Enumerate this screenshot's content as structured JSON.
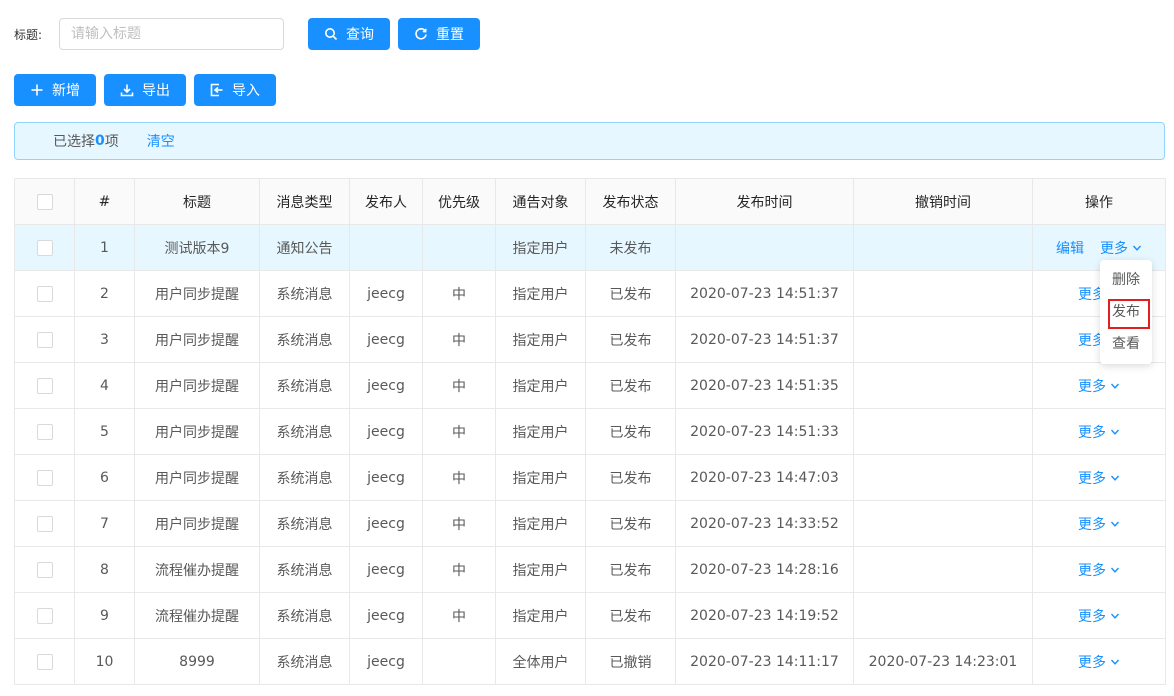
{
  "search": {
    "label": "标题:",
    "placeholder": "请输入标题",
    "query_label": "查询",
    "reset_label": "重置"
  },
  "toolbar": {
    "add_label": "新增",
    "export_label": "导出",
    "import_label": "导入"
  },
  "alert": {
    "prefix": "已选择",
    "count": "0",
    "suffix": "项",
    "clear_label": "清空"
  },
  "table": {
    "columns": [
      "#",
      "标题",
      "消息类型",
      "发布人",
      "优先级",
      "通告对象",
      "发布状态",
      "发布时间",
      "撤销时间",
      "操作"
    ],
    "rows": [
      {
        "idx": "1",
        "title": "测试版本9",
        "type": "通知公告",
        "publisher": "",
        "priority": "",
        "target": "指定用户",
        "status": "未发布",
        "publish_time": "",
        "revoke_time": "",
        "edit": "编辑",
        "more": "更多"
      },
      {
        "idx": "2",
        "title": "用户同步提醒",
        "type": "系统消息",
        "publisher": "jeecg",
        "priority": "中",
        "target": "指定用户",
        "status": "已发布",
        "publish_time": "2020-07-23 14:51:37",
        "revoke_time": "",
        "edit": "",
        "more": "更多"
      },
      {
        "idx": "3",
        "title": "用户同步提醒",
        "type": "系统消息",
        "publisher": "jeecg",
        "priority": "中",
        "target": "指定用户",
        "status": "已发布",
        "publish_time": "2020-07-23 14:51:37",
        "revoke_time": "",
        "edit": "",
        "more": "更多"
      },
      {
        "idx": "4",
        "title": "用户同步提醒",
        "type": "系统消息",
        "publisher": "jeecg",
        "priority": "中",
        "target": "指定用户",
        "status": "已发布",
        "publish_time": "2020-07-23 14:51:35",
        "revoke_time": "",
        "edit": "",
        "more": "更多"
      },
      {
        "idx": "5",
        "title": "用户同步提醒",
        "type": "系统消息",
        "publisher": "jeecg",
        "priority": "中",
        "target": "指定用户",
        "status": "已发布",
        "publish_time": "2020-07-23 14:51:33",
        "revoke_time": "",
        "edit": "",
        "more": "更多"
      },
      {
        "idx": "6",
        "title": "用户同步提醒",
        "type": "系统消息",
        "publisher": "jeecg",
        "priority": "中",
        "target": "指定用户",
        "status": "已发布",
        "publish_time": "2020-07-23 14:47:03",
        "revoke_time": "",
        "edit": "",
        "more": "更多"
      },
      {
        "idx": "7",
        "title": "用户同步提醒",
        "type": "系统消息",
        "publisher": "jeecg",
        "priority": "中",
        "target": "指定用户",
        "status": "已发布",
        "publish_time": "2020-07-23 14:33:52",
        "revoke_time": "",
        "edit": "",
        "more": "更多"
      },
      {
        "idx": "8",
        "title": "流程催办提醒",
        "type": "系统消息",
        "publisher": "jeecg",
        "priority": "中",
        "target": "指定用户",
        "status": "已发布",
        "publish_time": "2020-07-23 14:28:16",
        "revoke_time": "",
        "edit": "",
        "more": "更多"
      },
      {
        "idx": "9",
        "title": "流程催办提醒",
        "type": "系统消息",
        "publisher": "jeecg",
        "priority": "中",
        "target": "指定用户",
        "status": "已发布",
        "publish_time": "2020-07-23 14:19:52",
        "revoke_time": "",
        "edit": "",
        "more": "更多"
      },
      {
        "idx": "10",
        "title": "8999",
        "type": "系统消息",
        "publisher": "jeecg",
        "priority": "",
        "target": "全体用户",
        "status": "已撤销",
        "publish_time": "2020-07-23 14:11:17",
        "revoke_time": "2020-07-23 14:23:01",
        "edit": "",
        "more": "更多"
      }
    ]
  },
  "dropdown": {
    "items": [
      "删除",
      "发布",
      "查看"
    ],
    "highlighted": "发布"
  },
  "colors": {
    "primary": "#1890ff",
    "alert_bg": "#e6f7ff",
    "highlight_border": "#e02020"
  },
  "icons": {
    "query": "search-icon",
    "reset": "reload-icon",
    "add": "plus-icon",
    "export": "download-icon",
    "import": "import-icon",
    "more": "chevron-down-icon"
  }
}
